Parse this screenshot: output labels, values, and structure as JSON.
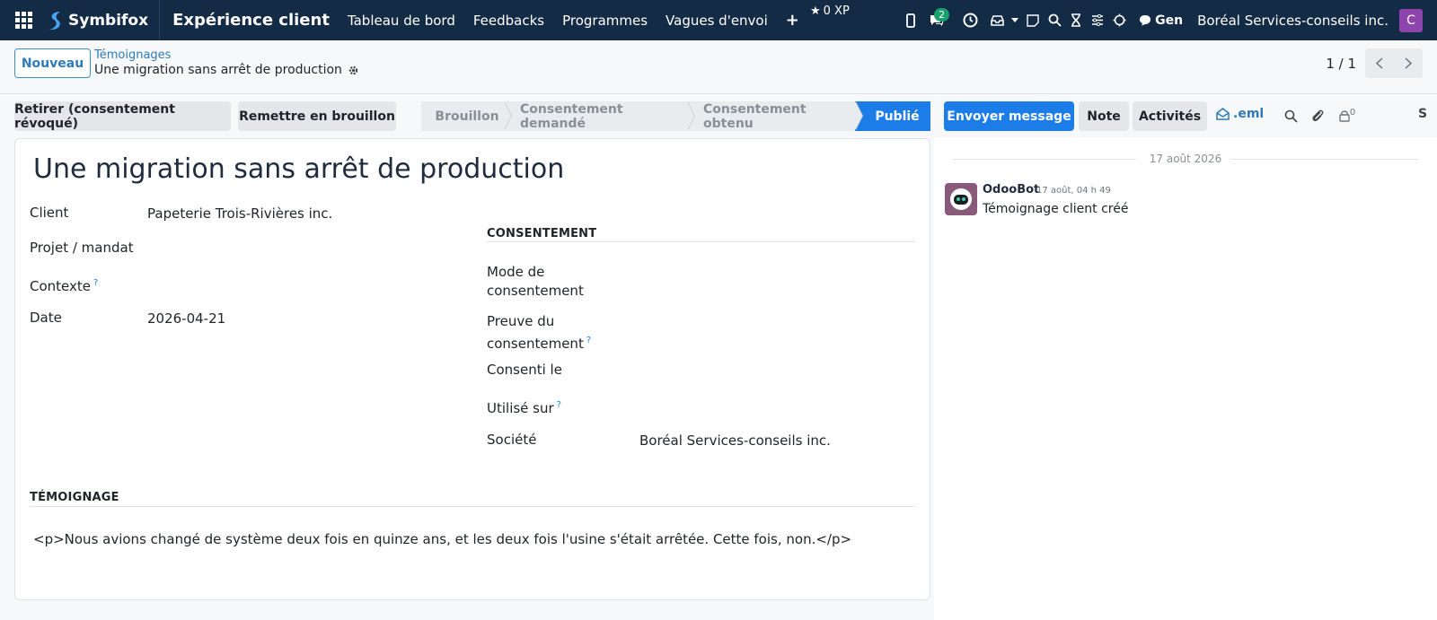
{
  "navbar": {
    "brand": "Symbifox",
    "app_name": "Expérience client",
    "menu": [
      "Tableau de bord",
      "Feedbacks",
      "Programmes",
      "Vagues d'envoi"
    ],
    "plus": "+",
    "xp": "0 XP",
    "chat_badge": "2",
    "gen_label": "Gen",
    "company": "Boréal Services-conseils inc.",
    "user_initial": "C",
    "avatar_color": "#8e44ad"
  },
  "control": {
    "new_label": "Nouveau",
    "breadcrumb_parent": "Témoignages",
    "record_name": "Une migration sans arrêt de production",
    "pager": "1 / 1"
  },
  "actions": {
    "withdraw": "Retirer (consentement révoqué)",
    "draft": "Remettre en brouillon"
  },
  "stages": [
    {
      "label": "Brouillon"
    },
    {
      "label": "Consentement demandé"
    },
    {
      "label": "Consentement obtenu"
    },
    {
      "label": "Publié",
      "active": true
    }
  ],
  "form": {
    "title": "Une migration sans arrêt de production",
    "client_label": "Client",
    "client_value": "Papeterie Trois-Rivières inc.",
    "project_label": "Projet / mandat",
    "context_label": "Contexte",
    "date_label": "Date",
    "date_value": "2026-04-21",
    "consent_section": "CONSENTEMENT",
    "consent_mode_label": "Mode de consentement",
    "consent_proof_label": "Preuve du consentement",
    "consented_on_label": "Consenti le",
    "used_on_label": "Utilisé sur",
    "company_label": "Société",
    "company_value": "Boréal Services-conseils inc.",
    "testimony_section": "TÉMOIGNAGE",
    "testimony_text": "<p>Nous avions changé de système deux fois en quinze ans, et les deux fois l'usine s'était arrêtée. Cette fois, non.</p>",
    "help_mark": "?"
  },
  "chatter": {
    "send_message": "Envoyer message",
    "note": "Note",
    "activities": "Activités",
    "eml": ".eml",
    "followers_count": "0",
    "truncated": "S",
    "date_separator": "17 août 2026",
    "message": {
      "author": "OdooBot",
      "time": "17 août, 04 h 49",
      "body": "Témoignage client créé"
    }
  },
  "colors": {
    "navbar": "#142b46",
    "primary": "#1d7de8",
    "link": "#2f7ab8"
  }
}
